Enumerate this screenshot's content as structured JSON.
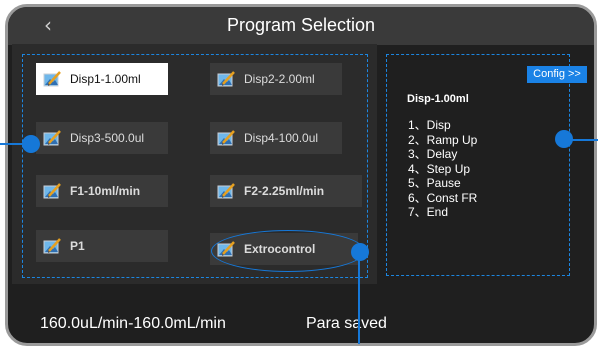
{
  "header": {
    "title": "Program Selection",
    "back_icon": "chevron-left-icon"
  },
  "programs": [
    {
      "label": "Disp1-1.00ml",
      "selected": true
    },
    {
      "label": "Disp2-2.00ml",
      "selected": false
    },
    {
      "label": "Disp3-500.0ul",
      "selected": false
    },
    {
      "label": "Disp4-100.0ul",
      "selected": false
    },
    {
      "label": "F1-10ml/min",
      "selected": false
    },
    {
      "label": "F2-2.25ml/min",
      "selected": false
    },
    {
      "label": "P1",
      "selected": false
    },
    {
      "label": "Extrocontrol",
      "selected": false
    }
  ],
  "details": {
    "config_label": "Config >>",
    "title": "Disp-1.00ml",
    "steps": [
      "1、Disp",
      "2、Ramp Up",
      "3、Delay",
      "4、Step Up",
      "5、Pause",
      "6、Const FR",
      "7、End"
    ]
  },
  "status": {
    "flow_range": "160.0uL/min-160.0mL/min",
    "message": "Para saved"
  },
  "colors": {
    "accent": "#1a82e6",
    "background": "#1f1f1f",
    "panel": "#2b2b2b",
    "button": "#3a3a3a"
  },
  "icons": {
    "program_icon": "edit-picture-icon"
  }
}
